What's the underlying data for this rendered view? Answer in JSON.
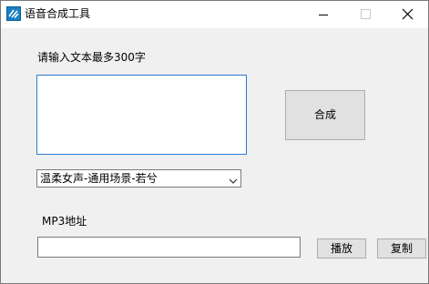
{
  "window": {
    "title": "语音合成工具",
    "icon": "app-icon",
    "controls": {
      "minimize_icon": "minimize-icon",
      "maximize_icon": "maximize-icon",
      "close_icon": "close-icon"
    }
  },
  "form": {
    "text_label": "请输入文本最多300字",
    "text_value": "",
    "synth_button": "合成",
    "voice_select": {
      "selected": "温柔女声-通用场景-若兮"
    },
    "mp3_label": "MP3地址",
    "mp3_value": "",
    "play_button": "播放",
    "copy_button": "复制"
  },
  "colors": {
    "focus_border": "#2b7bd0",
    "button_bg": "#e1e1e1",
    "window_bg": "#f0f0f0"
  }
}
